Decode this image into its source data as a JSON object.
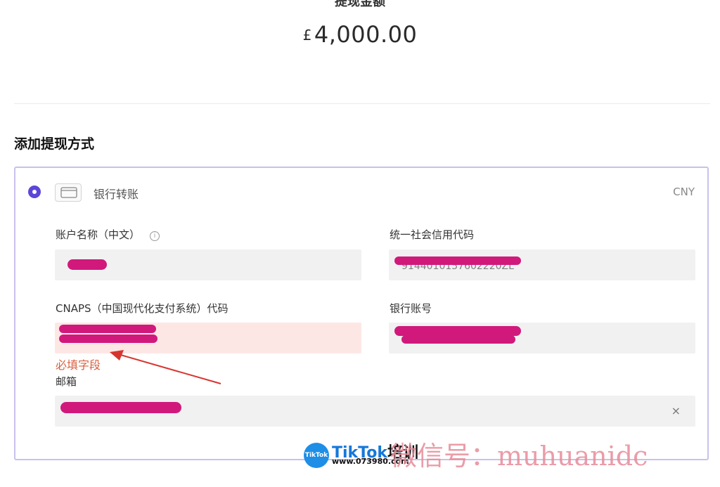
{
  "summary": {
    "amount_label": "提现金额",
    "currency_symbol": "£",
    "amount": "4,000.00"
  },
  "section": {
    "title": "添加提现方式"
  },
  "method": {
    "label": "银行转账",
    "currency": "CNY",
    "selected": true
  },
  "fields": {
    "account_name": {
      "label": "账户名称（中文）"
    },
    "credit_code": {
      "label": "统一社会信用代码",
      "partial_value": "9144010157602220ZL"
    },
    "cnaps": {
      "label": "CNAPS（中国现代化支付系统）代码",
      "error": "必填字段"
    },
    "bank_account": {
      "label": "银行账号"
    },
    "email": {
      "label": "邮箱",
      "clear": "×"
    }
  },
  "watermark": {
    "logo": "TikTok",
    "brand": "TikTok",
    "brand_cn": "培训",
    "url": "www.073980.com",
    "wechat": "微信号：muhuanidc"
  },
  "colors": {
    "accent": "#5b46d8",
    "error": "#d8603f",
    "redaction": "#d1197c"
  }
}
